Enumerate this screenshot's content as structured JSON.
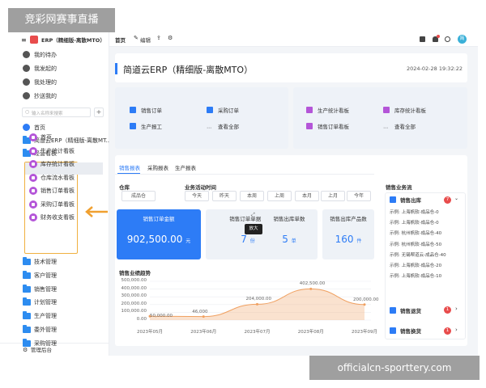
{
  "watermark_top": "竞彩网赛事直播",
  "watermark_bottom": "officialcn-sporttery.com",
  "sidebar": {
    "brand": "ERP（精细版-离散MTO）",
    "quick": [
      "我的待办",
      "我发起的",
      "我处理的",
      "抄送我的"
    ],
    "search_placeholder": "输入名称来搜索",
    "home": "首页",
    "app": "简道云ERP（精细版-离散MT...",
    "group": "经营看板",
    "sub_items": [
      "首页",
      "生产统计看板",
      "库存统计看板",
      "仓库流水看板",
      "销售订单看板",
      "采购订单看板",
      "财务收支看板"
    ],
    "modules": [
      "技术管理",
      "客户管理",
      "销售管理",
      "计划管理",
      "生产管理",
      "委外管理",
      "采购管理"
    ],
    "footer": "管理后台"
  },
  "topbar": {
    "tab": "首页",
    "edit": "编辑",
    "avatar": "简"
  },
  "header": {
    "title": "简道云ERP（精细版-离散MTO）",
    "datetime": "2024-02-28 19:32:22"
  },
  "quick_actions_left": [
    {
      "label": "销售订单"
    },
    {
      "label": "采购订单"
    },
    {
      "label": "生产报工"
    },
    {
      "label": "查看全部"
    }
  ],
  "quick_actions_right": [
    {
      "label": "生产统计看板"
    },
    {
      "label": "库存统计看板"
    },
    {
      "label": "销售订单看板"
    },
    {
      "label": "查看全部"
    }
  ],
  "tabs": [
    "销售报表",
    "采购报表",
    "生产报表"
  ],
  "filters": {
    "warehouse_label": "仓库",
    "warehouse_value": "成品仓",
    "time_label": "业务活动时间",
    "options": [
      "今天",
      "昨天",
      "本周",
      "上周",
      "本月",
      "上月",
      "今年"
    ]
  },
  "stats": [
    {
      "label": "销售订单金额",
      "value": "902,500.00",
      "unit": "元"
    },
    {
      "label": "销售订单单据数",
      "value": "7",
      "unit": "份"
    },
    {
      "label": "销售出库单数",
      "value": "5",
      "unit": "单"
    },
    {
      "label": "销售出库产品数",
      "value": "160",
      "unit": "件"
    }
  ],
  "tooltip": "放大",
  "right_panel": {
    "title": "销售业务流",
    "section1": {
      "title": "销售出库",
      "badge": "7"
    },
    "rows": [
      "示例: 上海帆软-成品仓-0",
      "示例: 上海帆软-成品仓-0",
      "示例: 杭州帆软-成品仓-40",
      "示例: 杭州帆软-成品仓-50",
      "示例: 无锡帮道云-成品仓-40",
      "示例: 上海帆软-成品仓-20",
      "示例: 上海帆软-成品仓-10"
    ],
    "section2": {
      "title": "销售退货",
      "badge": "1"
    },
    "section3": {
      "title": "销售换货",
      "badge": "1"
    }
  },
  "chart_data": {
    "type": "area",
    "title": "销售业绩趋势",
    "x": [
      "2023年05月",
      "2023年06月",
      "2023年07月",
      "2023年08月",
      "2023年09月"
    ],
    "values": [
      50000,
      46000,
      204000,
      402500,
      200000
    ],
    "data_labels": [
      "50,000.00",
      "46,000",
      "204,000.00",
      "402,500.00",
      "200,000.00"
    ],
    "yticks": [
      "500,000.00",
      "400,000.00",
      "300,000.00",
      "200,000.00",
      "100,000.00",
      "0.00"
    ],
    "ylim": [
      0,
      500000
    ],
    "color": "#f0a060"
  },
  "colors": {
    "accent": "#2d7cf6",
    "purple": "#b455d8",
    "highlight": "#f0a030",
    "folder": "#2d8cf0"
  }
}
